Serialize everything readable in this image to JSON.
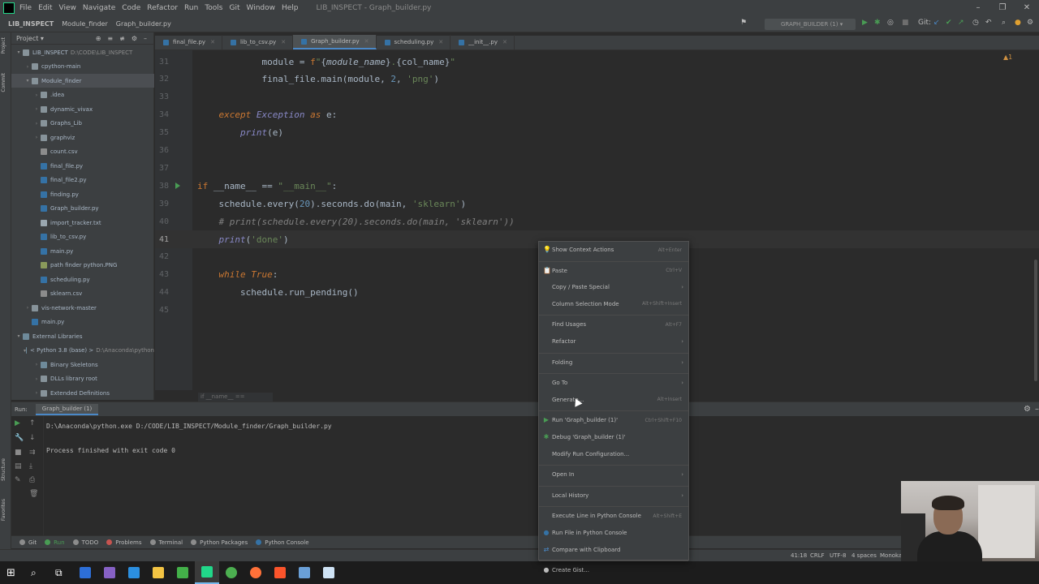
{
  "menubar": {
    "items": [
      "File",
      "Edit",
      "View",
      "Navigate",
      "Code",
      "Refactor",
      "Run",
      "Tools",
      "Git",
      "Window",
      "Help"
    ],
    "title": "LIB_INSPECT - Graph_builder.py"
  },
  "navbar": {
    "breadcrumbs": [
      "LIB_INSPECT",
      "Module_finder",
      "Graph_builder.py"
    ],
    "run_config": "GRAPH_BUILDER (1)",
    "git_label": "Git:"
  },
  "project": {
    "header": "Project",
    "rows": [
      {
        "label": "LIB_INSPECT",
        "extra": "D:\\CODE\\LIB_INSPECT",
        "type": "folder",
        "indent": 0,
        "arrow": "▾"
      },
      {
        "label": "cpython-main",
        "extra": "",
        "type": "folder",
        "indent": 1,
        "arrow": "›"
      },
      {
        "label": "Module_finder",
        "extra": "",
        "type": "folder",
        "indent": 1,
        "arrow": "▾",
        "selected": true
      },
      {
        "label": ".idea",
        "extra": "",
        "type": "folder",
        "indent": 2,
        "arrow": "›"
      },
      {
        "label": "dynamic_vivax",
        "extra": "",
        "type": "folder",
        "indent": 2,
        "arrow": "›"
      },
      {
        "label": "Graphs_Lib",
        "extra": "",
        "type": "folder",
        "indent": 2,
        "arrow": "›"
      },
      {
        "label": "graphviz",
        "extra": "",
        "type": "folder",
        "indent": 2,
        "arrow": "›"
      },
      {
        "label": "count.csv",
        "extra": "",
        "type": "csv",
        "indent": 2,
        "arrow": ""
      },
      {
        "label": "final_file.py",
        "extra": "",
        "type": "py",
        "indent": 2,
        "arrow": ""
      },
      {
        "label": "final_file2.py",
        "extra": "",
        "type": "py",
        "indent": 2,
        "arrow": ""
      },
      {
        "label": "finding.py",
        "extra": "",
        "type": "py",
        "indent": 2,
        "arrow": ""
      },
      {
        "label": "Graph_builder.py",
        "extra": "",
        "type": "py",
        "indent": 2,
        "arrow": ""
      },
      {
        "label": "import_tracker.txt",
        "extra": "",
        "type": "txt",
        "indent": 2,
        "arrow": ""
      },
      {
        "label": "lib_to_csv.py",
        "extra": "",
        "type": "py",
        "indent": 2,
        "arrow": ""
      },
      {
        "label": "main.py",
        "extra": "",
        "type": "py",
        "indent": 2,
        "arrow": ""
      },
      {
        "label": "path finder python.PNG",
        "extra": "",
        "type": "png",
        "indent": 2,
        "arrow": ""
      },
      {
        "label": "scheduling.py",
        "extra": "",
        "type": "py",
        "indent": 2,
        "arrow": ""
      },
      {
        "label": "sklearn.csv",
        "extra": "",
        "type": "csv",
        "indent": 2,
        "arrow": ""
      },
      {
        "label": "vis-network-master",
        "extra": "",
        "type": "folder",
        "indent": 1,
        "arrow": "›"
      },
      {
        "label": "main.py",
        "extra": "",
        "type": "py",
        "indent": 1,
        "arrow": ""
      },
      {
        "label": "External Libraries",
        "extra": "",
        "type": "lib",
        "indent": 0,
        "arrow": "▾"
      },
      {
        "label": "< Python 3.8 (base) >",
        "extra": "D:\\Anaconda\\python",
        "type": "lib",
        "indent": 1,
        "arrow": "▾"
      },
      {
        "label": "Binary Skeletons",
        "extra": "",
        "type": "lib",
        "indent": 2,
        "arrow": "›"
      },
      {
        "label": "DLLs  library root",
        "extra": "",
        "type": "folder",
        "indent": 2,
        "arrow": "›"
      },
      {
        "label": "Extended Definitions",
        "extra": "",
        "type": "folder",
        "indent": 2,
        "arrow": "›"
      }
    ]
  },
  "tabs": [
    {
      "label": "final_file.py",
      "active": false
    },
    {
      "label": "lib_to_csv.py",
      "active": false
    },
    {
      "label": "Graph_builder.py",
      "active": true
    },
    {
      "label": "scheduling.py",
      "active": false
    },
    {
      "label": "__init__.py",
      "active": false
    }
  ],
  "editor": {
    "lines": [
      {
        "n": "31",
        "html": "            <span class='cls'>module</span> = <span class='kw'>f</span><span class='str'>\"</span>{<span class='it'>module_name</span>}<span class='str'>.</span>{col_name}<span class='str'>\"</span>"
      },
      {
        "n": "32",
        "html": "            final_file.main(module, <span class='num'>2</span>, <span class='str'>'png'</span>)"
      },
      {
        "n": "33",
        "html": ""
      },
      {
        "n": "34",
        "html": "    <span class='kw it'>except</span> <span class='ital'>Exception</span> <span class='kw it'>as</span> e:"
      },
      {
        "n": "35",
        "html": "        <span class='ital'>print</span>(e)"
      },
      {
        "n": "36",
        "html": ""
      },
      {
        "n": "37",
        "html": ""
      },
      {
        "n": "38",
        "html": "<span class='kw'>if</span> __name__ == <span class='str'>\"__main__\"</span>:",
        "run": true
      },
      {
        "n": "39",
        "html": "    schedule.every(<span class='num'>20</span>).seconds.do(main, <span class='str'>'sklearn'</span>)"
      },
      {
        "n": "40",
        "html": "    <span class='cmt'># print(schedule.every(20).seconds.do(main, 'sklearn'))</span>"
      },
      {
        "n": "41",
        "html": "    <span class='ital'>print</span>(<span class='str'>'done'</span>)",
        "current": true
      },
      {
        "n": "42",
        "html": ""
      },
      {
        "n": "43",
        "html": "    <span class='kw it'>while</span> <span class='kw it'>True</span>:"
      },
      {
        "n": "44",
        "html": "        schedule.run_pending()"
      },
      {
        "n": "45",
        "html": ""
      }
    ],
    "footer_crumb": "if __name__ == '__main__'",
    "warning": "▲1"
  },
  "run": {
    "header_label": "Run:",
    "tab_label": "Graph_builder (1)",
    "output_lines": [
      "D:\\Anaconda\\python.exe D:/CODE/LIB_INSPECT/Module_finder/Graph_builder.py",
      "",
      "",
      "Process finished with exit code 0"
    ]
  },
  "bottom_tabs": [
    {
      "label": "Git",
      "color": "#8c8c8c"
    },
    {
      "label": "Run",
      "color": "#499c54"
    },
    {
      "label": "TODO",
      "color": "#8c8c8c"
    },
    {
      "label": "Problems",
      "color": "#c75450"
    },
    {
      "label": "Terminal",
      "color": "#8c8c8c"
    },
    {
      "label": "Python Packages",
      "color": "#8c8c8c"
    },
    {
      "label": "Python Console",
      "color": "#3572a5"
    }
  ],
  "status": {
    "position": "41:18",
    "line_sep": "CRLF",
    "encoding": "UTF-8",
    "indent": "4 spaces",
    "theme": "Monokai"
  },
  "context_menu": [
    {
      "label": "Show Context Actions",
      "shortcut": "Alt+Enter",
      "icon": "bulb-icon",
      "sub": false
    },
    {
      "sep": true
    },
    {
      "label": "Paste",
      "shortcut": "Ctrl+V",
      "icon": "clipboard-icon",
      "sub": false
    },
    {
      "label": "Copy / Paste Special",
      "shortcut": "",
      "icon": "",
      "sub": true
    },
    {
      "label": "Column Selection Mode",
      "shortcut": "Alt+Shift+Insert",
      "icon": "",
      "sub": false
    },
    {
      "sep": true
    },
    {
      "label": "Find Usages",
      "shortcut": "Alt+F7",
      "icon": "",
      "sub": false
    },
    {
      "label": "Refactor",
      "shortcut": "",
      "icon": "",
      "sub": true
    },
    {
      "sep": true
    },
    {
      "label": "Folding",
      "shortcut": "",
      "icon": "",
      "sub": true
    },
    {
      "sep": true
    },
    {
      "label": "Go To",
      "shortcut": "",
      "icon": "",
      "sub": true
    },
    {
      "label": "Generate...",
      "shortcut": "Alt+Insert",
      "icon": "",
      "sub": false
    },
    {
      "sep": true
    },
    {
      "label": "Run 'Graph_builder (1)'",
      "shortcut": "Ctrl+Shift+F10",
      "icon": "run-icon",
      "sub": false
    },
    {
      "label": "Debug 'Graph_builder (1)'",
      "shortcut": "",
      "icon": "debug-icon",
      "sub": false
    },
    {
      "label": "Modify Run Configuration...",
      "shortcut": "",
      "icon": "",
      "sub": false
    },
    {
      "sep": true
    },
    {
      "label": "Open In",
      "shortcut": "",
      "icon": "",
      "sub": true
    },
    {
      "sep": true
    },
    {
      "label": "Local History",
      "shortcut": "",
      "icon": "",
      "sub": true
    },
    {
      "sep": true
    },
    {
      "label": "Execute Line in Python Console",
      "shortcut": "Alt+Shift+E",
      "icon": "",
      "sub": false
    },
    {
      "label": "Run File in Python Console",
      "shortcut": "",
      "icon": "python-icon",
      "sub": false
    },
    {
      "label": "Compare with Clipboard",
      "shortcut": "",
      "icon": "compare-icon",
      "sub": false
    },
    {
      "sep": true
    },
    {
      "label": "Create Gist...",
      "shortcut": "",
      "icon": "github-icon",
      "sub": false
    }
  ],
  "taskbar": [
    {
      "name": "windows-start-icon",
      "color": "#ffffff"
    },
    {
      "name": "search-icon",
      "color": "#ffffff"
    },
    {
      "name": "task-view-icon",
      "color": "#ffffff"
    },
    {
      "name": "app-icon",
      "color": "#2d6fd8"
    },
    {
      "name": "visual-studio-icon",
      "color": "#8661c5"
    },
    {
      "name": "vscode-icon",
      "color": "#2b8fe0"
    },
    {
      "name": "file-explorer-icon",
      "color": "#f3c443"
    },
    {
      "name": "anaconda-icon",
      "color": "#43b049"
    },
    {
      "name": "pycharm-icon",
      "color": "#21d789",
      "active": true
    },
    {
      "name": "chrome-icon",
      "color": "#4caf50"
    },
    {
      "name": "firefox-icon",
      "color": "#ff7139"
    },
    {
      "name": "brave-icon",
      "color": "#fb542b"
    },
    {
      "name": "app2-icon",
      "color": "#6aa0d8"
    },
    {
      "name": "notepad-icon",
      "color": "#cfe3f5"
    }
  ]
}
